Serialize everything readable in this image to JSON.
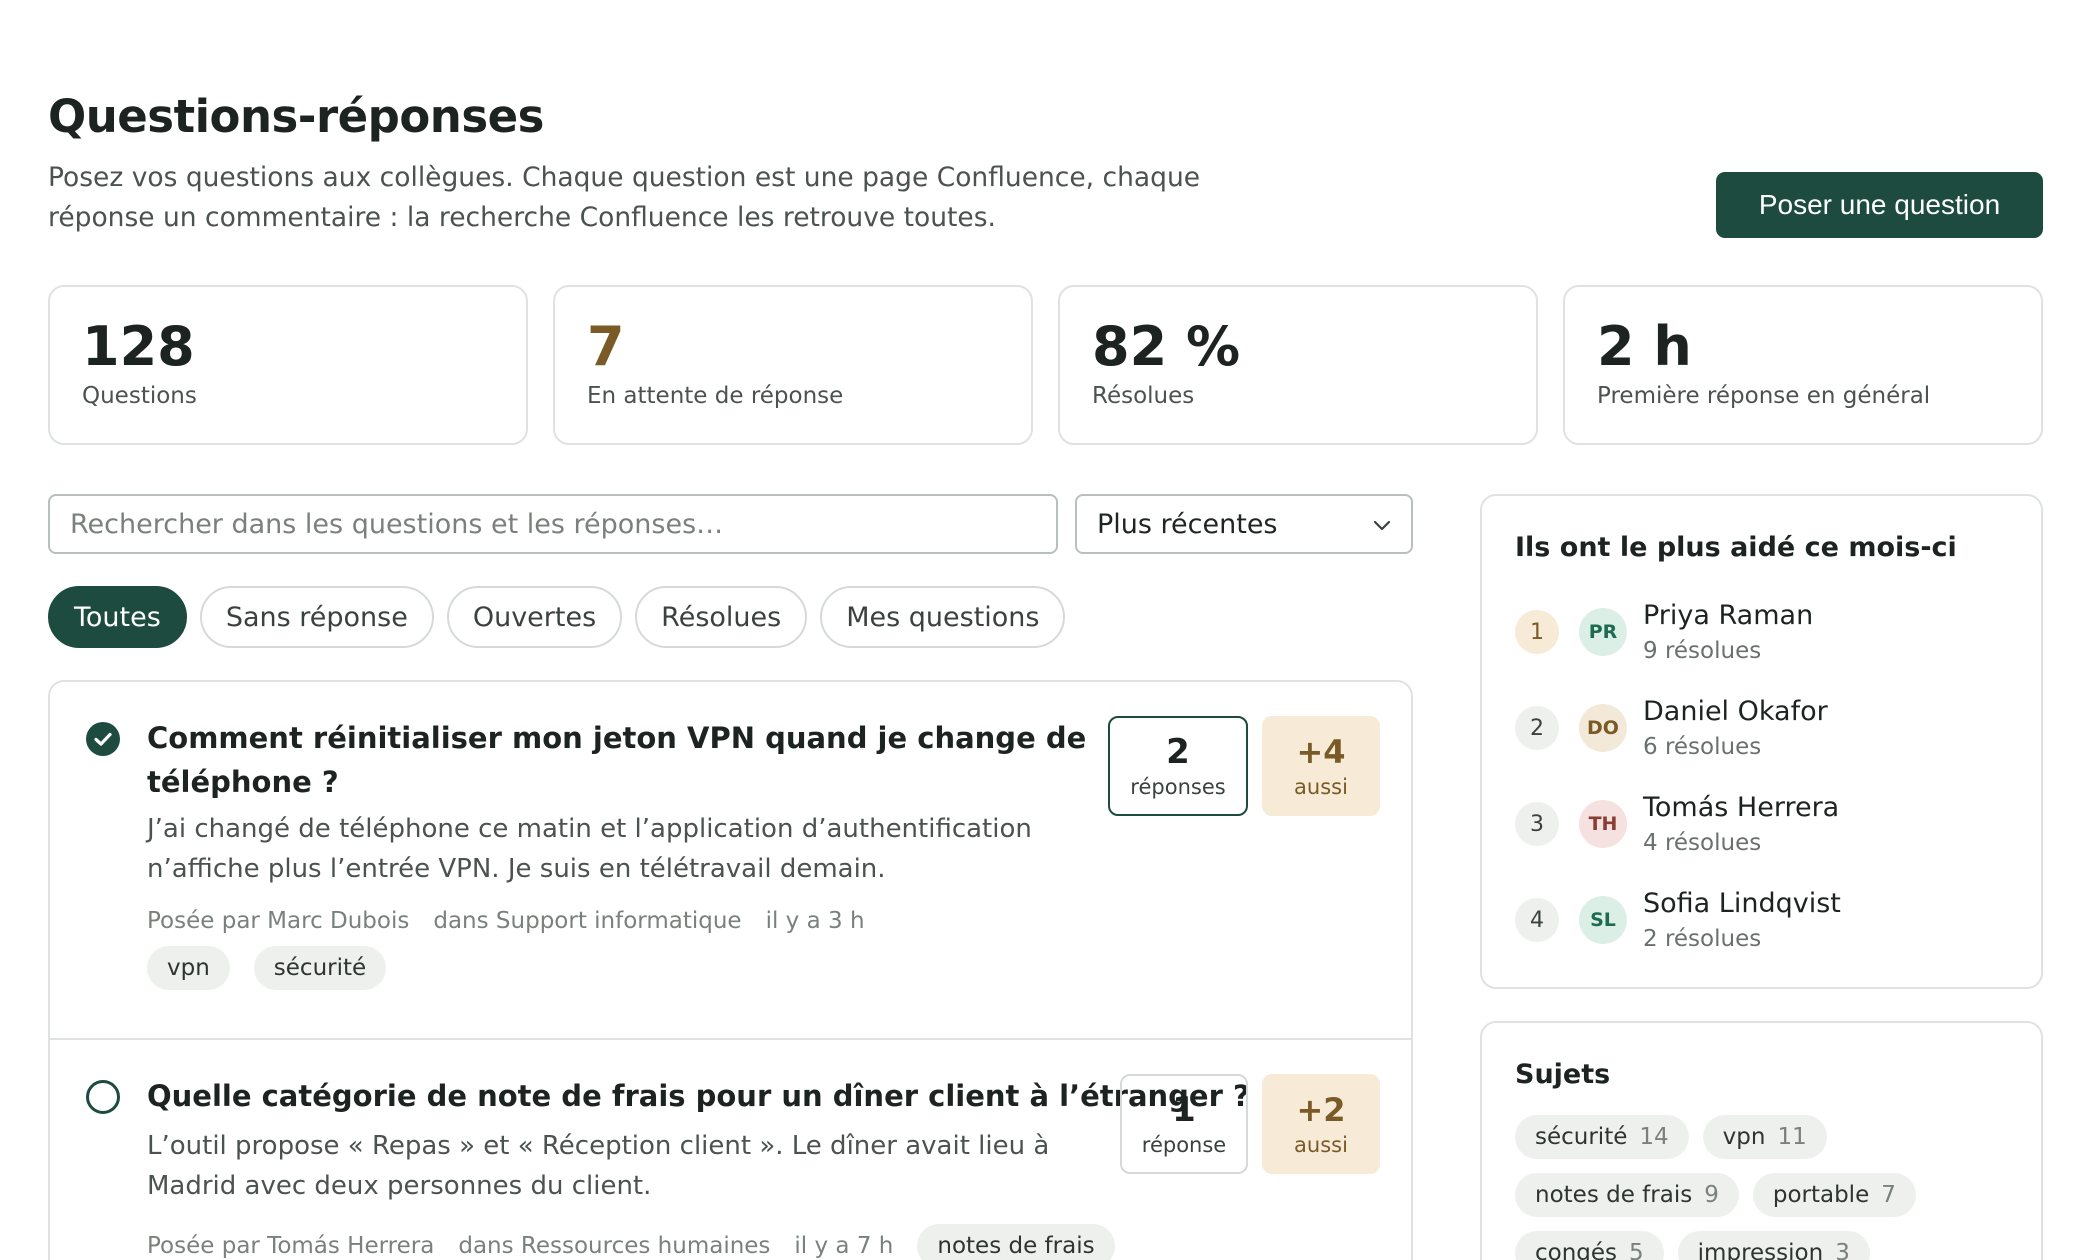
{
  "header": {
    "title": "Questions-réponses",
    "subtitle": "Posez vos questions aux collègues. Chaque question est une page Confluence, chaque réponse un commentaire : la recherche Confluence les retrouve toutes.",
    "ask_label": "Poser une question"
  },
  "stats": [
    {
      "value": "128",
      "label": "Questions"
    },
    {
      "value": "7",
      "label": "En attente de réponse"
    },
    {
      "value": "82 %",
      "label": "Résolues"
    },
    {
      "value": "2 h",
      "label": "Première réponse en général"
    }
  ],
  "search": {
    "placeholder": "Rechercher dans les questions et les réponses…",
    "sort_value": "Plus récentes"
  },
  "filters": [
    "Toutes",
    "Sans réponse",
    "Ouvertes",
    "Résolues",
    "Mes questions"
  ],
  "questions": [
    {
      "title_line1": "Comment réinitialiser mon jeton VPN quand je change de",
      "title_line2": "téléphone ?",
      "body_line1": "J’ai changé de téléphone ce matin et l’application d’authentification",
      "body_line2": "n’affiche plus l’entrée VPN. Je suis en télétravail demain.",
      "author": "Posée par Marc Dubois",
      "space": "dans Support informatique",
      "time": "il y a 3 h",
      "tags": [
        "vpn",
        "sécurité"
      ],
      "answers": "2",
      "answers_label": "réponses",
      "also": "+4",
      "also_label": "aussi"
    },
    {
      "title_line1": "Quelle catégorie de note de frais pour un dîner client à l’étranger ?",
      "body_line1": "L’outil propose « Repas » et « Réception client ». Le dîner avait lieu à",
      "body_line2": "Madrid avec deux personnes du client.",
      "author": "Posée par Tomás Herrera",
      "space": "dans Ressources humaines",
      "time": "il y a 7 h",
      "tags": [
        "notes de frais"
      ],
      "answers": "1",
      "answers_label": "réponse",
      "also": "+2",
      "also_label": "aussi"
    }
  ],
  "helpers": {
    "title": "Ils ont le plus aidé ce mois-ci",
    "items": [
      {
        "rank": "1",
        "initials": "PR",
        "name": "Priya Raman",
        "resolved": "9 résolues",
        "bg": "#dcefe6",
        "fg": "#1d6b52"
      },
      {
        "rank": "2",
        "initials": "DO",
        "name": "Daniel Okafor",
        "resolved": "6 résolues",
        "bg": "#f3e9d8",
        "fg": "#7a5a26"
      },
      {
        "rank": "3",
        "initials": "TH",
        "name": "Tomás Herrera",
        "resolved": "4 résolues",
        "bg": "#f5e1df",
        "fg": "#8a3d35"
      },
      {
        "rank": "4",
        "initials": "SL",
        "name": "Sofia Lindqvist",
        "resolved": "2 résolues",
        "bg": "#dcefe6",
        "fg": "#1d6b52"
      }
    ]
  },
  "topics": {
    "title": "Sujets",
    "items": [
      {
        "name": "sécurité",
        "count": "14"
      },
      {
        "name": "vpn",
        "count": "11"
      },
      {
        "name": "notes de frais",
        "count": "9"
      },
      {
        "name": "portable",
        "count": "7"
      },
      {
        "name": "congés",
        "count": "5"
      },
      {
        "name": "impression",
        "count": "3"
      }
    ]
  }
}
